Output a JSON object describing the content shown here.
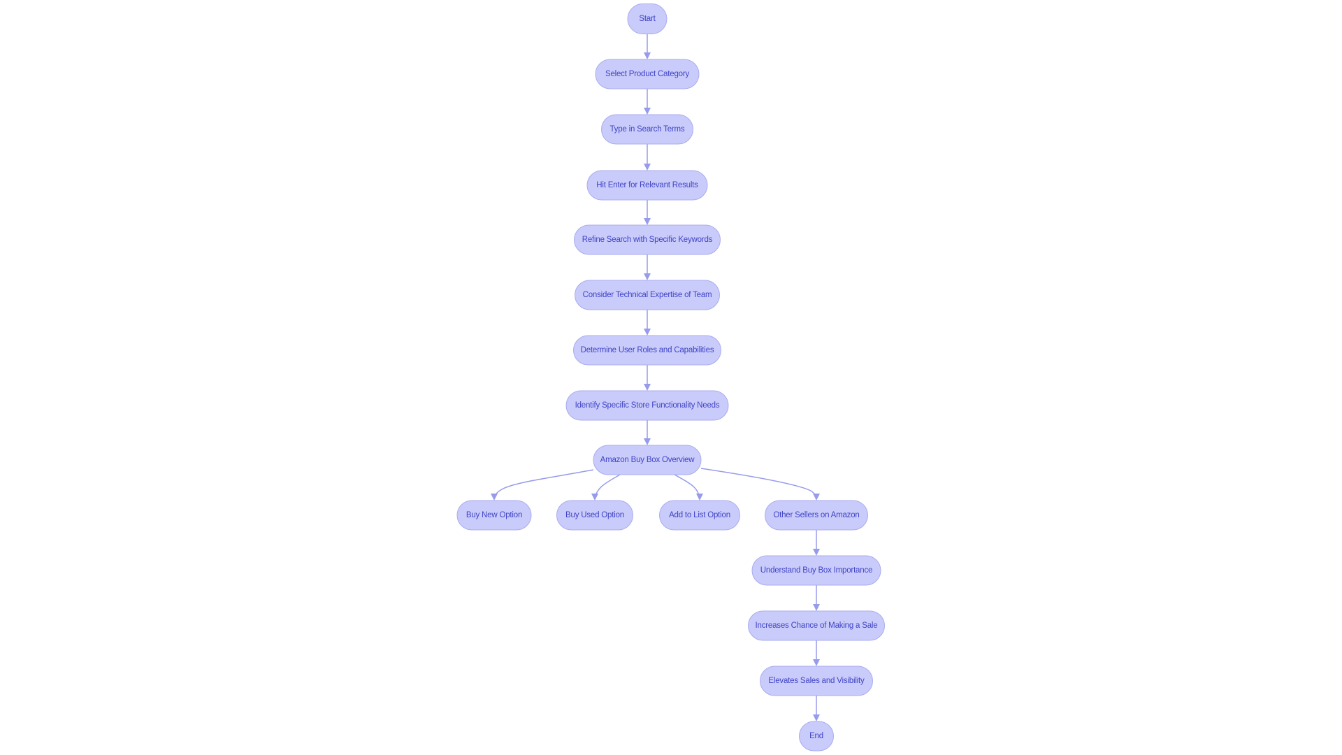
{
  "diagram": {
    "type": "flowchart",
    "direction": "top-down",
    "colors": {
      "node_fill": "#c9cbfb",
      "node_border": "#a9acee",
      "node_text": "#3f44c4",
      "edge": "#979beb",
      "background": "#ffffff"
    },
    "nodes": [
      {
        "id": "start",
        "label": "Start"
      },
      {
        "id": "select_category",
        "label": "Select Product Category"
      },
      {
        "id": "type_search",
        "label": "Type in Search Terms"
      },
      {
        "id": "hit_enter",
        "label": "Hit Enter for Relevant Results"
      },
      {
        "id": "refine_search",
        "label": "Refine Search with Specific Keywords"
      },
      {
        "id": "consider_expertise",
        "label": "Consider Technical Expertise of Team"
      },
      {
        "id": "determine_roles",
        "label": "Determine User Roles and Capabilities"
      },
      {
        "id": "identify_needs",
        "label": "Identify Specific Store Functionality Needs"
      },
      {
        "id": "buy_box_overview",
        "label": "Amazon Buy Box Overview"
      },
      {
        "id": "buy_new",
        "label": "Buy New Option"
      },
      {
        "id": "buy_used",
        "label": "Buy Used Option"
      },
      {
        "id": "add_to_list",
        "label": "Add to List Option"
      },
      {
        "id": "other_sellers",
        "label": "Other Sellers on Amazon"
      },
      {
        "id": "understand_importance",
        "label": "Understand Buy Box Importance"
      },
      {
        "id": "increases_chance",
        "label": "Increases Chance of Making a Sale"
      },
      {
        "id": "elevates_sales",
        "label": "Elevates Sales and Visibility"
      },
      {
        "id": "end",
        "label": "End"
      }
    ],
    "edges": [
      {
        "from": "start",
        "to": "select_category"
      },
      {
        "from": "select_category",
        "to": "type_search"
      },
      {
        "from": "type_search",
        "to": "hit_enter"
      },
      {
        "from": "hit_enter",
        "to": "refine_search"
      },
      {
        "from": "refine_search",
        "to": "consider_expertise"
      },
      {
        "from": "consider_expertise",
        "to": "determine_roles"
      },
      {
        "from": "determine_roles",
        "to": "identify_needs"
      },
      {
        "from": "identify_needs",
        "to": "buy_box_overview"
      },
      {
        "from": "buy_box_overview",
        "to": "buy_new"
      },
      {
        "from": "buy_box_overview",
        "to": "buy_used"
      },
      {
        "from": "buy_box_overview",
        "to": "add_to_list"
      },
      {
        "from": "buy_box_overview",
        "to": "other_sellers"
      },
      {
        "from": "other_sellers",
        "to": "understand_importance"
      },
      {
        "from": "understand_importance",
        "to": "increases_chance"
      },
      {
        "from": "increases_chance",
        "to": "elevates_sales"
      },
      {
        "from": "elevates_sales",
        "to": "end"
      }
    ]
  }
}
